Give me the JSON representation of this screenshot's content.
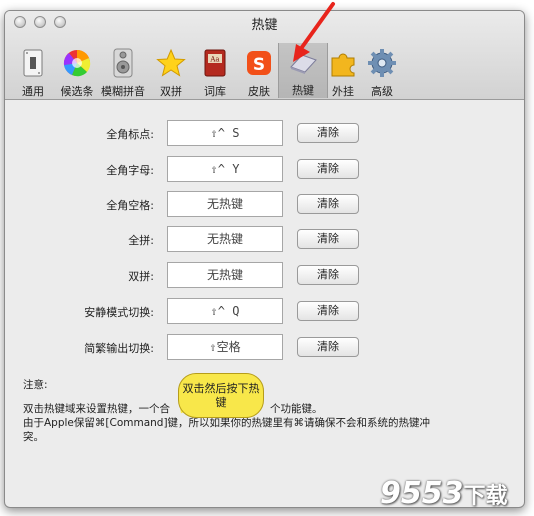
{
  "window": {
    "title": "热键"
  },
  "toolbar": {
    "items": [
      {
        "label": "通用",
        "icon": "switch-icon"
      },
      {
        "label": "候选条",
        "icon": "color-wheel-icon"
      },
      {
        "label": "模糊拼音",
        "icon": "speaker-icon"
      },
      {
        "label": "双拼",
        "icon": "star-icon"
      },
      {
        "label": "词库",
        "icon": "dictionary-icon"
      },
      {
        "label": "皮肤",
        "icon": "sogou-icon"
      },
      {
        "label": "热键",
        "icon": "keyboard-key-icon",
        "selected": true
      },
      {
        "label": "外挂",
        "icon": "puzzle-icon"
      },
      {
        "label": "高级",
        "icon": "gear-icon"
      }
    ]
  },
  "hotkeys": [
    {
      "label": "全角标点:",
      "value": "⇧^ S",
      "button": "清除"
    },
    {
      "label": "全角字母:",
      "value": "⇧^ Y",
      "button": "清除"
    },
    {
      "label": "全角空格:",
      "value": "无热键",
      "button": "清除"
    },
    {
      "label": "全拼:",
      "value": "无热键",
      "button": "清除"
    },
    {
      "label": "双拼:",
      "value": "无热键",
      "button": "清除"
    },
    {
      "label": "安静模式切换:",
      "value": "⇧^ Q",
      "button": "清除"
    },
    {
      "label": "简繁输出切换:",
      "value": "⇧空格",
      "button": "清除"
    }
  ],
  "notes": {
    "heading": "注意:",
    "line1a": "双击热键域来设置热键，一个合",
    "line1b": "个功能键。",
    "line2": "由于Apple保留⌘[Command]键，所以如果你的热键里有⌘请确保不会和系统的热键冲",
    "line3": "突。"
  },
  "callout": {
    "text": "双击然后按下热键"
  },
  "watermark": {
    "main": "9553",
    "sub": "下载"
  },
  "colors": {
    "arrow": "#e8241c",
    "callout": "#f8e74a"
  }
}
